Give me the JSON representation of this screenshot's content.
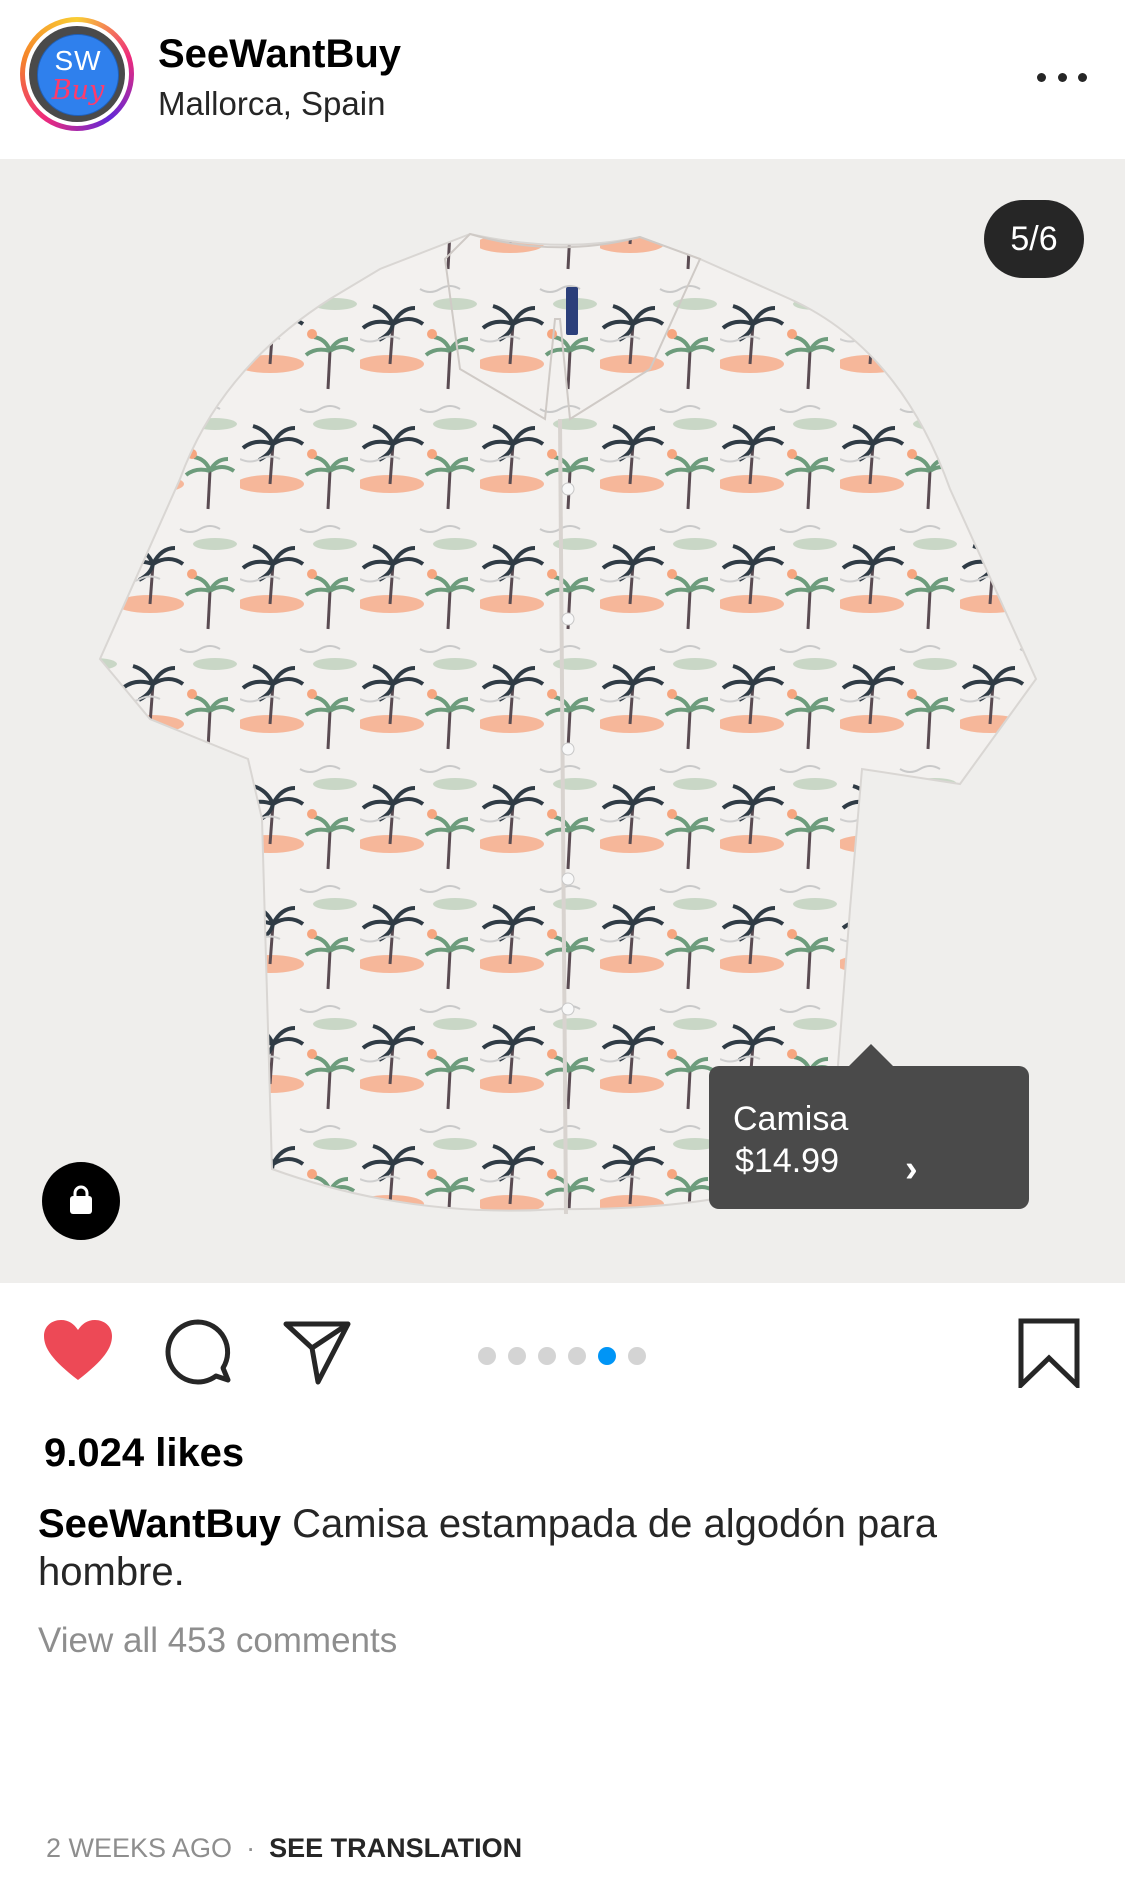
{
  "header": {
    "username": "SeeWantBuy",
    "location": "Mallorca, Spain",
    "avatar_text_top": "SW",
    "avatar_text_bottom": "Buy"
  },
  "post": {
    "counter": "5/6",
    "product": {
      "name": "Camisa",
      "price": "$14.99"
    },
    "carousel": {
      "total": 6,
      "active_index": 5
    },
    "likes": "9.024 likes",
    "caption_user": "SeeWantBuy",
    "caption_text": "Camisa estampada de algodón para hombre.",
    "comments_link": "View all 453 comments",
    "timestamp": "2 WEEKS AGO",
    "separator": "·",
    "translate": "SEE TRANSLATION"
  },
  "icons": [
    "more-icon",
    "shopping-bag-icon",
    "heart-icon",
    "comment-icon",
    "share-icon",
    "bookmark-icon",
    "chevron-right-icon"
  ],
  "colors": {
    "like": "#ed4956",
    "active_dot": "#0095f6",
    "tooltip": "#4a4a4a",
    "muted_text": "#8e8e8e"
  }
}
